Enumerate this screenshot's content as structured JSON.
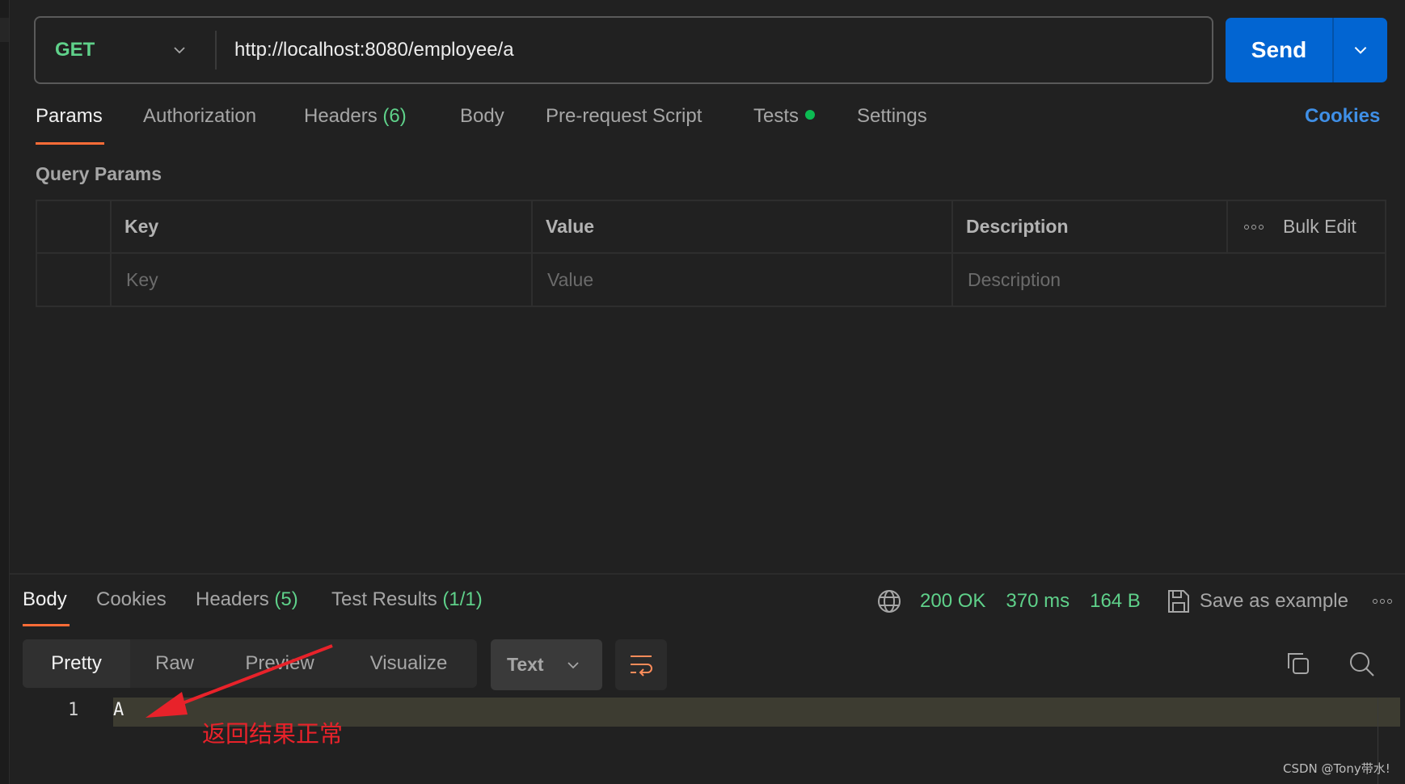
{
  "request": {
    "method": "GET",
    "url": "http://localhost:8080/employee/a",
    "send_label": "Send",
    "method_color": "#5fd18a",
    "send_color": "#0265d2"
  },
  "request_tabs": [
    {
      "label": "Params",
      "active": true
    },
    {
      "label": "Authorization"
    },
    {
      "label": "Headers",
      "count": "(6)"
    },
    {
      "label": "Body"
    },
    {
      "label": "Pre-request Script"
    },
    {
      "label": "Tests",
      "indicator": "green-dot"
    },
    {
      "label": "Settings"
    }
  ],
  "cookies_link": "Cookies",
  "query_params": {
    "title": "Query Params",
    "columns": [
      "Key",
      "Value",
      "Description"
    ],
    "bulk_edit": "Bulk Edit",
    "placeholders": {
      "key": "Key",
      "value": "Value",
      "description": "Description"
    }
  },
  "response_tabs": [
    {
      "label": "Body",
      "active": true
    },
    {
      "label": "Cookies"
    },
    {
      "label": "Headers",
      "count": "(5)"
    },
    {
      "label": "Test Results",
      "count": "(1/1)"
    }
  ],
  "response_status": {
    "status": "200 OK",
    "time": "370 ms",
    "size": "164 B",
    "save_example": "Save as example"
  },
  "view_modes": [
    {
      "label": "Pretty",
      "active": true
    },
    {
      "label": "Raw"
    },
    {
      "label": "Preview"
    },
    {
      "label": "Visualize"
    }
  ],
  "format_select": "Text",
  "response_body": [
    {
      "line": "1",
      "text": "A"
    }
  ],
  "annotation": "返回结果正常",
  "watermark": "CSDN @Tony带水!"
}
